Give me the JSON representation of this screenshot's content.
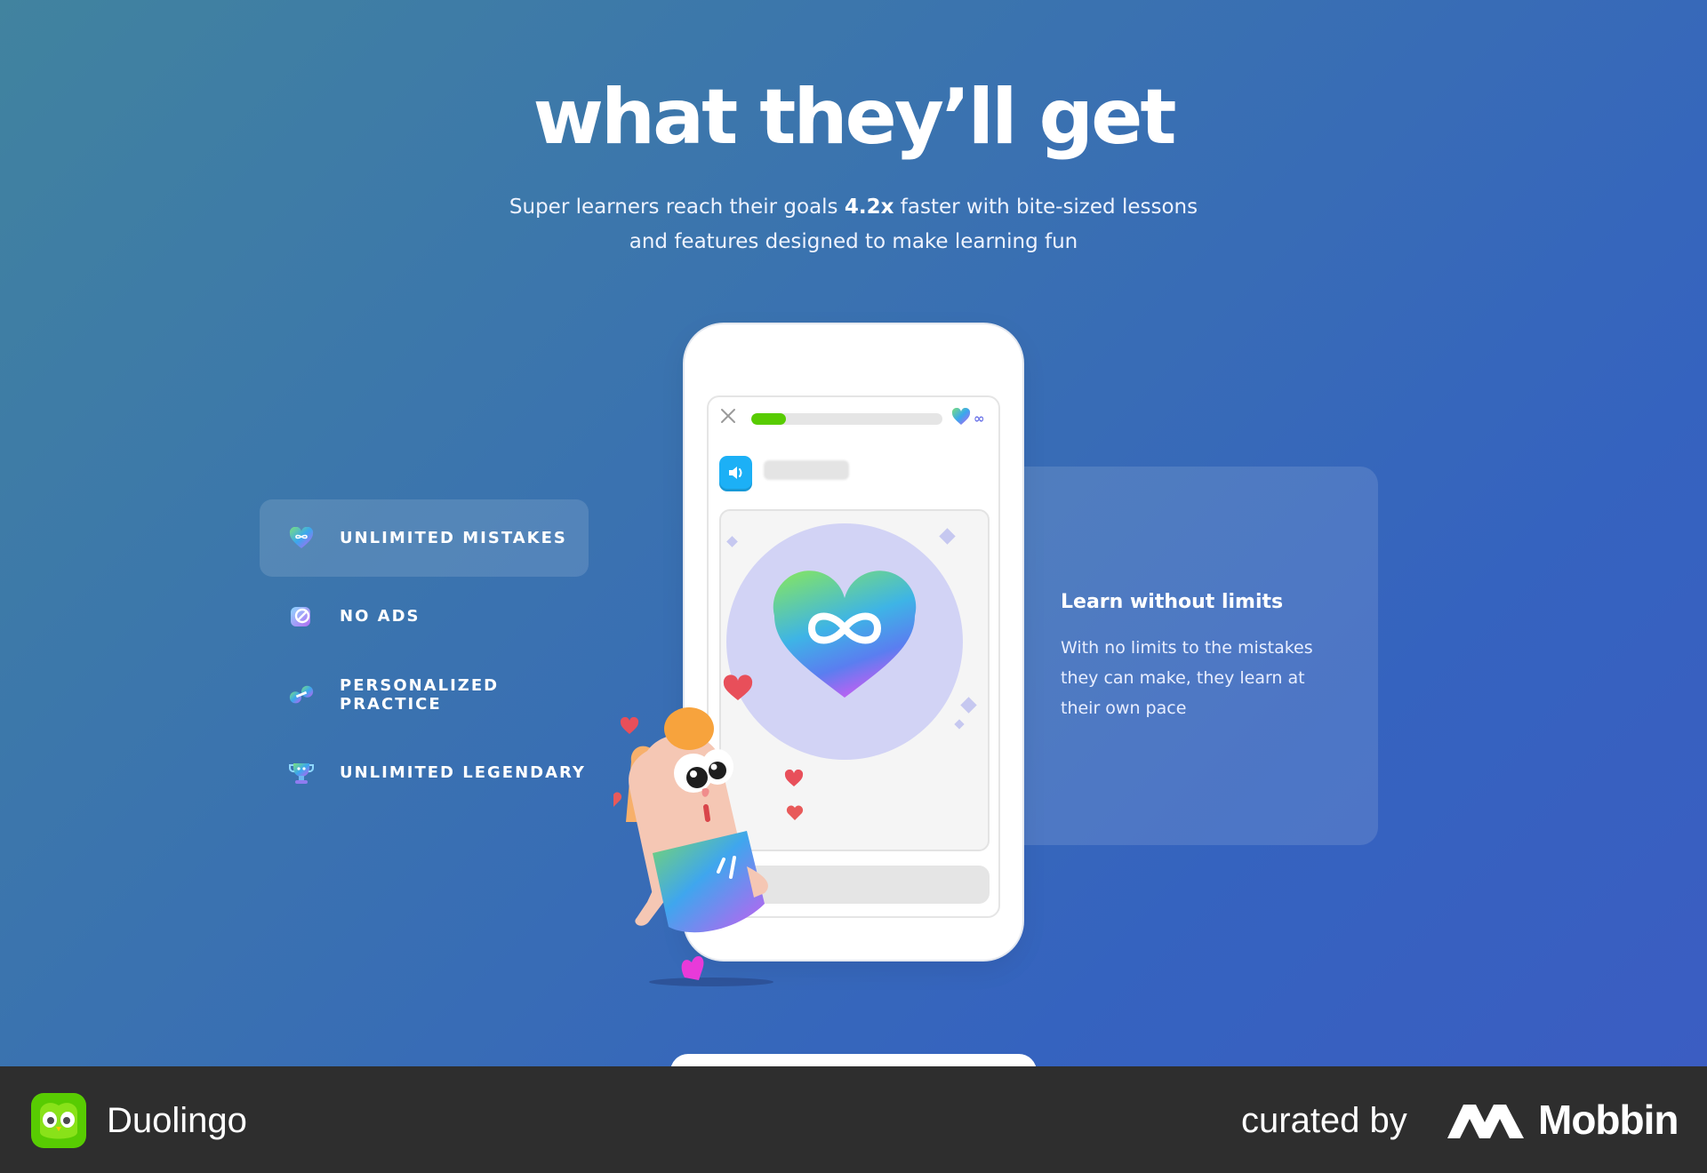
{
  "hero": {
    "title": "what they’ll get",
    "subtitle_part1": "Super learners reach their goals ",
    "subtitle_highlight": "4.2x",
    "subtitle_part2": " faster with bite-sized lessons and features designed to make learning fun"
  },
  "features": [
    {
      "label": "UNLIMITED MISTAKES",
      "icon": "infinity-heart-icon",
      "active": true
    },
    {
      "label": "NO ADS",
      "icon": "no-ads-icon",
      "active": false
    },
    {
      "label": "PERSONALIZED PRACTICE",
      "icon": "dumbbell-icon",
      "active": false
    },
    {
      "label": "UNLIMITED LEGENDARY",
      "icon": "trophy-icon",
      "active": false
    }
  ],
  "feature_detail": {
    "title": "Learn without limits",
    "text": "With no limits to the mistakes they can make, they learn at their own pace"
  },
  "phone": {
    "progress": 0.18,
    "hearts_value": "∞"
  },
  "footer": {
    "brand": "Duolingo",
    "curated_by": "curated by",
    "curator": "Mobbin"
  },
  "colors": {
    "background_start": "#41839f",
    "background_end": "#3b5dc2",
    "footer": "#2e2e2e",
    "progress_green": "#58cc02",
    "speaker_blue": "#1cb0f6"
  }
}
